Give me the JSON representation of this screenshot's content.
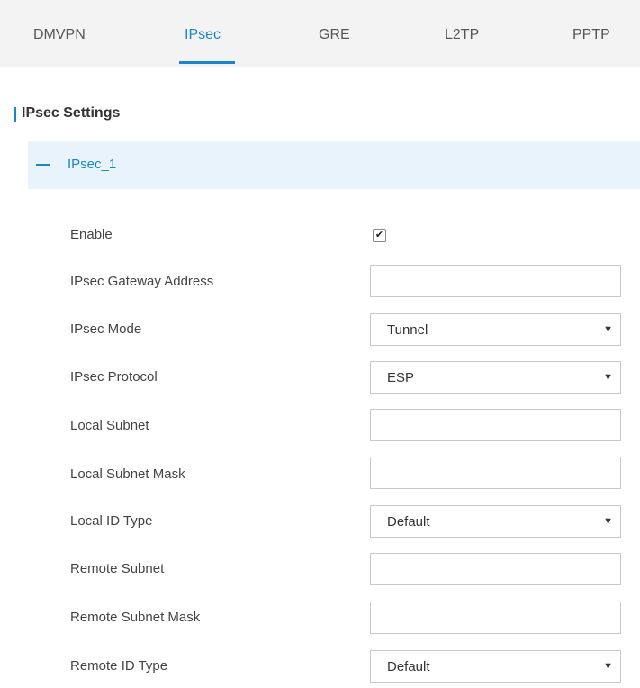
{
  "tabs": {
    "items": [
      {
        "label": "DMVPN",
        "active": false
      },
      {
        "label": "IPsec",
        "active": true
      },
      {
        "label": "GRE",
        "active": false
      },
      {
        "label": "L2TP",
        "active": false
      },
      {
        "label": "PPTP",
        "active": false
      }
    ]
  },
  "section": {
    "title": "IPsec Settings"
  },
  "panel": {
    "title": "IPsec_1",
    "expanded": true
  },
  "form": {
    "enable": {
      "label": "Enable",
      "checked": true,
      "check_glyph": "✔"
    },
    "gateway_address": {
      "label": "IPsec Gateway Address",
      "value": ""
    },
    "mode": {
      "label": "IPsec Mode",
      "value": "Tunnel"
    },
    "protocol": {
      "label": "IPsec Protocol",
      "value": "ESP"
    },
    "local_subnet": {
      "label": "Local Subnet",
      "value": ""
    },
    "local_subnet_mask": {
      "label": "Local Subnet Mask",
      "value": ""
    },
    "local_id_type": {
      "label": "Local ID Type",
      "value": "Default"
    },
    "remote_subnet": {
      "label": "Remote Subnet",
      "value": ""
    },
    "remote_subnet_mask": {
      "label": "Remote Subnet Mask",
      "value": ""
    },
    "remote_id_type": {
      "label": "Remote ID Type",
      "value": "Default"
    }
  },
  "icons": {
    "dropdown_arrow": "▼"
  },
  "colors": {
    "accent": "#1a86c8",
    "panel_bg": "#e8f3fb",
    "tabbar_bg": "#f3f3f3"
  }
}
